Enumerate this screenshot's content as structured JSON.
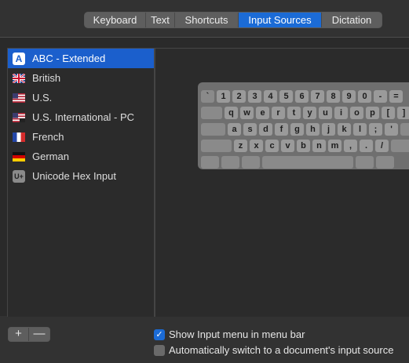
{
  "tabs": [
    {
      "label": "Keyboard",
      "active": false
    },
    {
      "label": "Text",
      "active": false
    },
    {
      "label": "Shortcuts",
      "active": false
    },
    {
      "label": "Input Sources",
      "active": true
    },
    {
      "label": "Dictation",
      "active": false
    }
  ],
  "sources": [
    {
      "label": "ABC - Extended",
      "icon": "abc-extended-icon",
      "glyph": "A",
      "selected": true
    },
    {
      "label": "British",
      "icon": "uk-flag-icon",
      "selected": false
    },
    {
      "label": "U.S.",
      "icon": "us-flag-icon",
      "selected": false
    },
    {
      "label": "U.S. International - PC",
      "icon": "us-pc-flag-icon",
      "selected": false
    },
    {
      "label": "French",
      "icon": "france-flag-icon",
      "selected": false
    },
    {
      "label": "German",
      "icon": "germany-flag-icon",
      "selected": false
    },
    {
      "label": "Unicode Hex Input",
      "icon": "unicode-hex-icon",
      "glyph": "U+",
      "selected": false
    }
  ],
  "keyboard_rows": [
    [
      "`",
      "1",
      "2",
      "3",
      "4",
      "5",
      "6",
      "7",
      "8",
      "9",
      "0",
      "-",
      "="
    ],
    [
      "q",
      "w",
      "e",
      "r",
      "t",
      "y",
      "u",
      "i",
      "o",
      "p",
      "[",
      "]"
    ],
    [
      "a",
      "s",
      "d",
      "f",
      "g",
      "h",
      "j",
      "k",
      "l",
      ";",
      "'"
    ],
    [
      "z",
      "x",
      "c",
      "v",
      "b",
      "n",
      "m",
      ",",
      ".",
      "/"
    ]
  ],
  "buttons": {
    "add": "+",
    "remove": "—"
  },
  "options": {
    "show_menu": {
      "label": "Show Input menu in menu bar",
      "checked": true
    },
    "auto_switch": {
      "label": "Automatically switch to a document's input source",
      "checked": false
    }
  },
  "colors": {
    "accent": "#1b6bd6",
    "selection": "#1b5fcc"
  }
}
